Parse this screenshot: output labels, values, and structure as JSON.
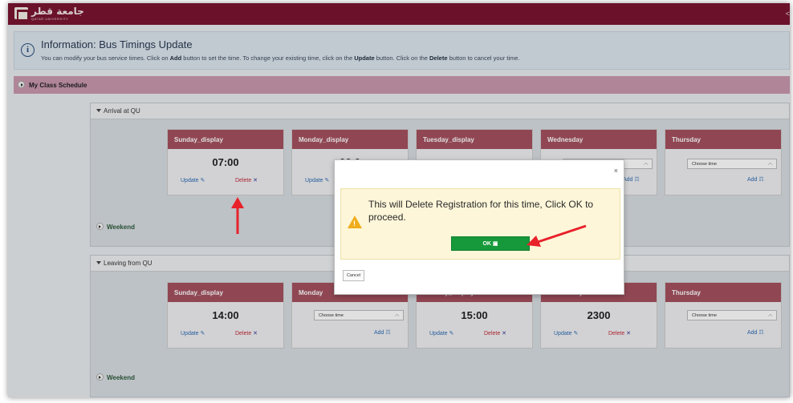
{
  "topbar": {
    "logo_arabic": "جامعة قطر",
    "logo_english": "QATAR UNIVERSITY",
    "right_glyph": "<"
  },
  "info": {
    "title": "Information: Bus Timings Update",
    "text_1": "You can modify your bus service times. Click on ",
    "add": "Add",
    "text_2": " button to set the time. To change your existing time, click on the ",
    "update": "Update",
    "text_3": " button. Click on the ",
    "delete": "Delete",
    "text_4": " button to cancel your time."
  },
  "class_schedule_label": "My Class Schedule",
  "arrival": {
    "title": "Arrival at QU",
    "cards": [
      {
        "head": "Sunday_display",
        "time": "07:00",
        "update": "Update",
        "delete": "Delete"
      },
      {
        "head": "Monday_display",
        "time": "06:0",
        "update": "Update"
      },
      {
        "head": "Tuesday_display"
      },
      {
        "head": "Wednesday",
        "add": "Add"
      },
      {
        "head": "Thursday",
        "select": "Choose time",
        "add": "Add"
      }
    ],
    "weekend": "Weekend"
  },
  "leaving": {
    "title": "Leaving from QU",
    "cards": [
      {
        "head": "Sunday_display",
        "time": "14:00",
        "update": "Update",
        "delete": "Delete"
      },
      {
        "head": "Monday",
        "select": "Choose time",
        "add": "Add"
      },
      {
        "head": "Tuesday_display",
        "time": "15:00",
        "update": "Update",
        "delete": "Delete"
      },
      {
        "head": "Wednesday",
        "time": "2300",
        "update": "Update",
        "delete": "Delete"
      },
      {
        "head": "Thursday",
        "select": "Choose time",
        "add": "Add"
      }
    ],
    "weekend": "Weekend"
  },
  "modal": {
    "close": "×",
    "message": "This will Delete Registration for this time, Click OK to proceed.",
    "ok": "OK",
    "cancel": "Cancel"
  },
  "colors": {
    "brand": "#7a1530",
    "card_header": "#a4515f",
    "ok_green": "#16993a",
    "arrow_red": "#e8212a"
  }
}
